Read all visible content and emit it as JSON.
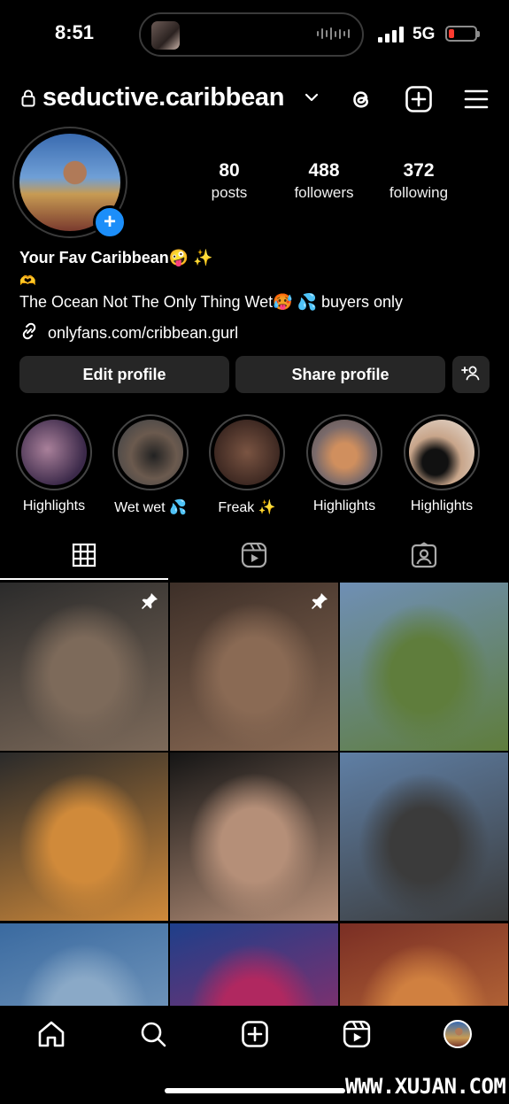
{
  "status_bar": {
    "time": "8:51",
    "network": "5G"
  },
  "header": {
    "username": "seductive.caribbean"
  },
  "profile": {
    "stats": [
      {
        "value": "80",
        "label": "posts"
      },
      {
        "value": "488",
        "label": "followers"
      },
      {
        "value": "372",
        "label": "following"
      }
    ],
    "display_name": "Your Fav Caribbean🤪 ✨",
    "bio_line1": "🫶",
    "bio_line2": "The Ocean Not The Only Thing Wet🥵 💦 buyers only",
    "link": "onlyfans.com/cribbean.gurl"
  },
  "buttons": {
    "edit": "Edit profile",
    "share": "Share profile"
  },
  "highlights": [
    {
      "label": "Highlights",
      "cover": "#3c2a4a"
    },
    {
      "label": "Wet wet 💦",
      "cover": "#4a4848"
    },
    {
      "label": "Freak ✨",
      "cover": "#3a2620"
    },
    {
      "label": "Highlights",
      "cover": "#7a6a6a"
    },
    {
      "label": "Highlights",
      "cover": "#c8a58a"
    }
  ],
  "grid": [
    {
      "color1": "#2b2b2b",
      "color2": "#7d6a5a",
      "pinned": true
    },
    {
      "color1": "#3d2f28",
      "color2": "#8a6a54",
      "pinned": true
    },
    {
      "color1": "#6f8fb5",
      "color2": "#5f7d3c",
      "pinned": false
    },
    {
      "color1": "#2a2a2a",
      "color2": "#d08a3a",
      "pinned": false
    },
    {
      "color1": "#151515",
      "color2": "#b58f78",
      "pinned": false
    },
    {
      "color1": "#5f7fa5",
      "color2": "#3b3b3b",
      "pinned": false
    },
    {
      "color1": "#3a6aa0",
      "color2": "#8aa9c7",
      "pinned": false
    },
    {
      "color1": "#1e3f8a",
      "color2": "#b02860",
      "pinned": false
    },
    {
      "color1": "#7a2e24",
      "color2": "#d08040",
      "pinned": false
    }
  ],
  "watermark": "WWW.XUJAN.COM",
  "colors": {
    "accent": "#1c8ef9",
    "battery_low": "#ff3b30",
    "button_bg": "#262626"
  }
}
